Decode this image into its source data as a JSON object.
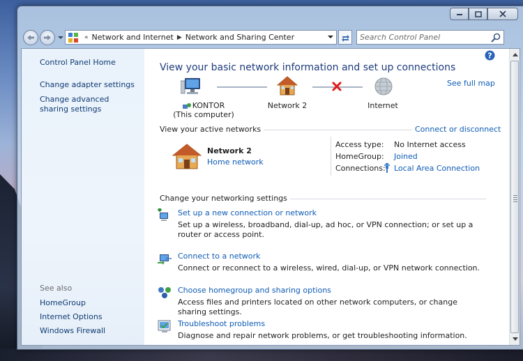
{
  "window": {
    "caption": {
      "minimize": "minimize",
      "maximize": "maximize",
      "close": "close"
    }
  },
  "address_bar": {
    "overflow_glyph": "«",
    "segments": [
      "Network and Internet",
      "Network and Sharing Center"
    ]
  },
  "search": {
    "placeholder": "Search Control Panel"
  },
  "sidebar": {
    "items": [
      {
        "label": "Control Panel Home"
      },
      {
        "label": "Change adapter settings"
      },
      {
        "label": "Change advanced sharing settings"
      }
    ],
    "see_also_title": "See also",
    "see_also": [
      {
        "label": "HomeGroup"
      },
      {
        "label": "Internet Options"
      },
      {
        "label": "Windows Firewall"
      }
    ]
  },
  "main": {
    "title": "View your basic network information and set up connections",
    "see_full_map": "See full map",
    "map": {
      "computer_name": "KONTOR",
      "computer_sub": "(This computer)",
      "network_name": "Network  2",
      "internet": "Internet"
    },
    "active": {
      "section": "View your active networks",
      "action": "Connect or disconnect",
      "network_name": "Network  2",
      "network_type": "Home network",
      "access_type_label": "Access type:",
      "access_type_value": "No Internet access",
      "homegroup_label": "HomeGroup:",
      "homegroup_value": "Joined",
      "connections_label": "Connections:",
      "connections_value": "Local Area Connection"
    },
    "settings": {
      "section": "Change your networking settings",
      "tasks": [
        {
          "link": "Set up a new connection or network",
          "desc": "Set up a wireless, broadband, dial-up, ad hoc, or VPN connection; or set up a router or access point."
        },
        {
          "link": "Connect to a network",
          "desc": "Connect or reconnect to a wireless, wired, dial-up, or VPN network connection."
        },
        {
          "link": "Choose homegroup and sharing options",
          "desc": "Access files and printers located on other network computers, or change sharing settings."
        },
        {
          "link": "Troubleshoot problems",
          "desc": "Diagnose and repair network problems, or get troubleshooting information."
        }
      ]
    }
  },
  "colors": {
    "link": "#0e5bb5",
    "title": "#1e3c7b",
    "sidebar_bg": "#e9f2fb"
  }
}
